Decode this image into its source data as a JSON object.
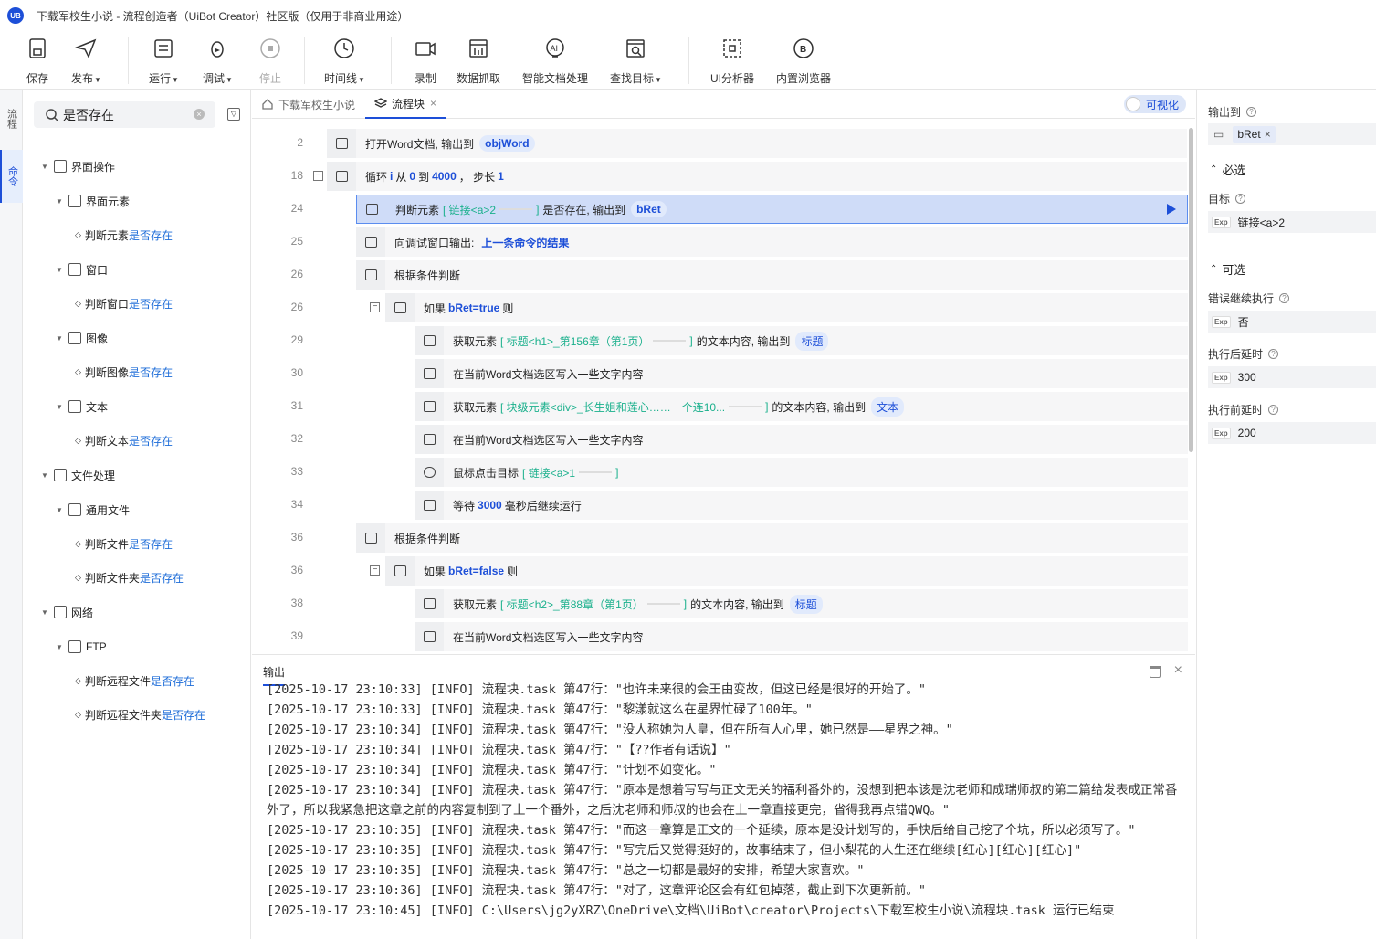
{
  "window": {
    "title": "下载军校生小说 - 流程创造者（UiBot Creator）社区版（仅用于非商业用途）",
    "logo": "UB"
  },
  "toolbar": {
    "save": "保存",
    "publish": "发布",
    "run": "运行",
    "debug": "调试",
    "stop": "停止",
    "timeline": "时间线",
    "record": "录制",
    "data_scrape": "数据抓取",
    "smart_doc": "智能文档处理",
    "find_target": "查找目标",
    "ui_analyzer": "UI分析器",
    "builtin_browser": "内置浏览器"
  },
  "left_strip": {
    "tab1": "流程",
    "tab2": "命令"
  },
  "search": {
    "value": "是否存在"
  },
  "tree": [
    {
      "label": "界面操作",
      "kind": "group"
    },
    {
      "label": "界面元素",
      "kind": "sub"
    },
    {
      "prefix": "判断元素",
      "match": "是否存在",
      "kind": "leaf"
    },
    {
      "label": "窗口",
      "kind": "sub"
    },
    {
      "prefix": "判断窗口",
      "match": "是否存在",
      "kind": "leaf"
    },
    {
      "label": "图像",
      "kind": "sub"
    },
    {
      "prefix": "判断图像",
      "match": "是否存在",
      "kind": "leaf"
    },
    {
      "label": "文本",
      "kind": "sub"
    },
    {
      "prefix": "判断文本",
      "match": "是否存在",
      "kind": "leaf"
    },
    {
      "label": "文件处理",
      "kind": "group"
    },
    {
      "label": "通用文件",
      "kind": "sub"
    },
    {
      "prefix": "判断文件",
      "match": "是否存在",
      "kind": "leaf"
    },
    {
      "prefix": "判断文件夹",
      "match": "是否存在",
      "kind": "leaf"
    },
    {
      "label": "网络",
      "kind": "group"
    },
    {
      "label": "FTP",
      "kind": "sub"
    },
    {
      "prefix": "判断远程文件",
      "match": "是否存在",
      "kind": "leaf"
    },
    {
      "prefix": "判断远程文件夹",
      "match": "是否存在",
      "kind": "leaf"
    }
  ],
  "tabs": {
    "tab1": "下载军校生小说",
    "tab2": "流程块",
    "visual_toggle": "可视化"
  },
  "code": {
    "r1": {
      "ln": "2",
      "a": "打开Word文档, 输出到",
      "var": "objWord"
    },
    "r2": {
      "ln": "18",
      "a": "循环",
      "i": "i",
      "b": "从",
      "from": "0",
      "c": "到",
      "to": "4000",
      "d": "， 步长",
      "step": "1"
    },
    "r3": {
      "ln": "24",
      "a": "判断元素",
      "target": "[ 链接<a>2",
      "close": "]",
      "b": "是否存在, 输出到",
      "var": "bRet"
    },
    "r4": {
      "ln": "25",
      "a": "向调试窗口输出:",
      "val": "上一条命令的结果"
    },
    "r5": {
      "ln": "26",
      "a": "根据条件判断"
    },
    "r6": {
      "ln": "26",
      "a": "如果",
      "cond": "bRet=true",
      "b": "则"
    },
    "r7": {
      "ln": "29",
      "a": "获取元素",
      "target": "[ 标题<h1>_第156章（第1页）",
      "close": "]",
      "b": "的文本内容, 输出到",
      "var": "标题"
    },
    "r8": {
      "ln": "30",
      "a": "在当前Word文档选区写入一些文字内容"
    },
    "r9": {
      "ln": "31",
      "a": "获取元素",
      "target": "[ 块级元素<div>_长生姐和莲心……一个连10...",
      "close": "]",
      "b": "的文本内容, 输出到",
      "var": "文本"
    },
    "r10": {
      "ln": "32",
      "a": "在当前Word文档选区写入一些文字内容"
    },
    "r11": {
      "ln": "33",
      "a": "鼠标点击目标",
      "target": "[ 链接<a>1",
      "close": "]"
    },
    "r12": {
      "ln": "34",
      "a": "等待",
      "ms": "3000",
      "b": "毫秒后继续运行"
    },
    "r13": {
      "ln": "36",
      "a": "根据条件判断"
    },
    "r14": {
      "ln": "36",
      "a": "如果",
      "cond": "bRet=false",
      "b": "则"
    },
    "r15": {
      "ln": "38",
      "a": "获取元素",
      "target": "[ 标题<h2>_第88章（第1页）",
      "close": "]",
      "b": "的文本内容, 输出到",
      "var": "标题"
    },
    "r16": {
      "ln": "39",
      "a": "在当前Word文档选区写入一些文字内容"
    }
  },
  "output": {
    "tab": "输出",
    "lines": [
      "[2025-10-17 23:10:33] [INFO] 流程块.task 第47行：\"也许未来很的会王由变故，但这已经是很好的开始了。\"",
      "[2025-10-17 23:10:33] [INFO] 流程块.task 第47行：\"黎漾就这么在星界忙碌了100年。\"",
      "[2025-10-17 23:10:34] [INFO] 流程块.task 第47行：\"没人称她为人皇，但在所有人心里，她已然是——星界之神。\"",
      "[2025-10-17 23:10:34] [INFO] 流程块.task 第47行：\"【??作者有话说】\"",
      "[2025-10-17 23:10:34] [INFO] 流程块.task 第47行：\"计划不如变化。\"",
      "[2025-10-17 23:10:34] [INFO] 流程块.task 第47行：\"原本是想着写写与正文无关的福利番外的，没想到把本该是沈老师和成瑞师叔的第二篇给发表成正常番外了，所以我紧急把这章之前的内容复制到了上一个番外，之后沈老师和师叔的也会在上一章直接更完，省得我再点错QWQ。\"",
      "[2025-10-17 23:10:35] [INFO] 流程块.task 第47行：\"而这一章算是正文的一个延续，原本是没计划写的，手快后给自己挖了个坑，所以必须写了。\"",
      "[2025-10-17 23:10:35] [INFO] 流程块.task 第47行：\"写完后又觉得挺好的，故事结束了，但小梨花的人生还在继续[红心][红心][红心]\"",
      "[2025-10-17 23:10:35] [INFO] 流程块.task 第47行：\"总之一切都是最好的安排，希望大家喜欢。\"",
      "[2025-10-17 23:10:36] [INFO] 流程块.task 第47行：\"对了，这章评论区会有红包掉落，截止到下次更新前。\"",
      "[2025-10-17 23:10:45] [INFO] C:\\Users\\jg2yXRZ\\OneDrive\\文档\\UiBot\\creator\\Projects\\下载军校生小说\\流程块.task 运行已结束"
    ]
  },
  "props": {
    "output_to_label": "输出到",
    "output_var": "bRet",
    "required_section": "必选",
    "target_label": "目标",
    "target_value": "链接<a>2",
    "optional_section": "可选",
    "continue_on_error_label": "错误继续执行",
    "continue_on_error_value": "否",
    "delay_after_label": "执行后延时",
    "delay_after_value": "300",
    "delay_before_label": "执行前延时",
    "delay_before_value": "200",
    "exp_tag": "Exp"
  }
}
